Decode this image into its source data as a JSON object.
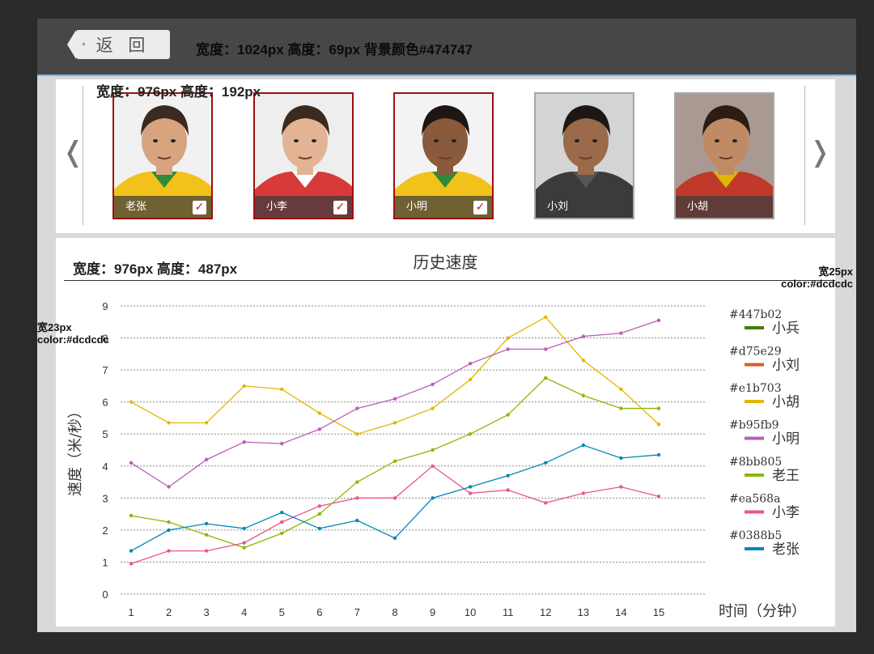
{
  "topbar": {
    "back_label": "返 回",
    "spec_note": "宽度：1024px  高度：69px  背景颜色#474747"
  },
  "players_panel": {
    "spec_note": "宽度：976px  高度：192px",
    "prev_arrow": "❬",
    "next_arrow": "❭",
    "cards": [
      {
        "name": "老张",
        "selected": true,
        "check": "✓",
        "jersey": "#f2c21b",
        "collar": "#2f8a3a",
        "hair": "#3a2a1f",
        "skin": "#d7a47f",
        "bg": "#f1f1f1"
      },
      {
        "name": "小李",
        "selected": true,
        "check": "✓",
        "jersey": "#d83a3a",
        "collar": "#ffffff",
        "hair": "#3b2b1e",
        "skin": "#e2b494",
        "bg": "#eeeeee"
      },
      {
        "name": "小明",
        "selected": true,
        "check": "✓",
        "jersey": "#f2c21b",
        "collar": "#2f8a3a",
        "hair": "#1e1612",
        "skin": "#8a5a3c",
        "bg": "#f3f3f3"
      },
      {
        "name": "小刘",
        "selected": false,
        "jersey": "#3b3b3b",
        "collar": "#555555",
        "hair": "#1c1714",
        "skin": "#9a6a4a",
        "bg": "#d4d4d4"
      },
      {
        "name": "小胡",
        "selected": false,
        "jersey": "#c0392b",
        "collar": "#e1b703",
        "hair": "#2b1c14",
        "skin": "#c08a64",
        "bg": "#a89a92"
      }
    ]
  },
  "chart_panel": {
    "spec_note": "宽度：976px  高度：487px",
    "left_note": [
      "宽23px",
      "color:#dcdcdc"
    ],
    "right_note": [
      "宽25px",
      "color:#dcdcdc"
    ]
  },
  "chart_data": {
    "type": "line",
    "title": "历史速度",
    "xlabel": "时间（分钟）",
    "ylabel": "速度（米/秒）",
    "x": [
      1,
      2,
      3,
      4,
      5,
      6,
      7,
      8,
      9,
      10,
      11,
      12,
      13,
      14,
      15
    ],
    "ylim": [
      0,
      9
    ],
    "yticks": [
      0,
      1,
      2,
      3,
      4,
      5,
      6,
      7,
      8,
      9
    ],
    "grid": true,
    "legend_position": "right",
    "series": [
      {
        "name": "小兵",
        "color": "#447b02",
        "values": []
      },
      {
        "name": "小刘",
        "color": "#d75e29",
        "values": []
      },
      {
        "name": "小胡",
        "color": "#e1b703",
        "values": [
          6.0,
          5.35,
          5.35,
          6.5,
          6.4,
          5.65,
          5.0,
          5.35,
          5.8,
          6.7,
          8.0,
          8.65,
          7.3,
          6.4,
          5.3
        ]
      },
      {
        "name": "小明",
        "color": "#b95fb9",
        "values": [
          4.1,
          3.35,
          4.2,
          4.75,
          4.7,
          5.15,
          5.8,
          6.1,
          6.55,
          7.2,
          7.65,
          7.65,
          8.05,
          8.15,
          8.55
        ]
      },
      {
        "name": "老王",
        "color": "#8bb805",
        "values": [
          2.45,
          2.25,
          1.85,
          1.45,
          1.9,
          2.5,
          3.5,
          4.15,
          4.5,
          5.0,
          5.6,
          6.75,
          6.2,
          5.8,
          5.8
        ]
      },
      {
        "name": "小李",
        "color": "#ea568a",
        "values": [
          0.95,
          1.35,
          1.35,
          1.6,
          2.25,
          2.75,
          3.0,
          3.0,
          4.0,
          3.15,
          3.25,
          2.85,
          3.15,
          3.35,
          3.05
        ]
      },
      {
        "name": "老张",
        "color": "#0388b5",
        "values": [
          1.35,
          2.0,
          2.2,
          2.05,
          2.55,
          2.05,
          2.3,
          1.75,
          3.0,
          3.35,
          3.7,
          4.1,
          4.65,
          4.25,
          4.35
        ]
      }
    ]
  }
}
